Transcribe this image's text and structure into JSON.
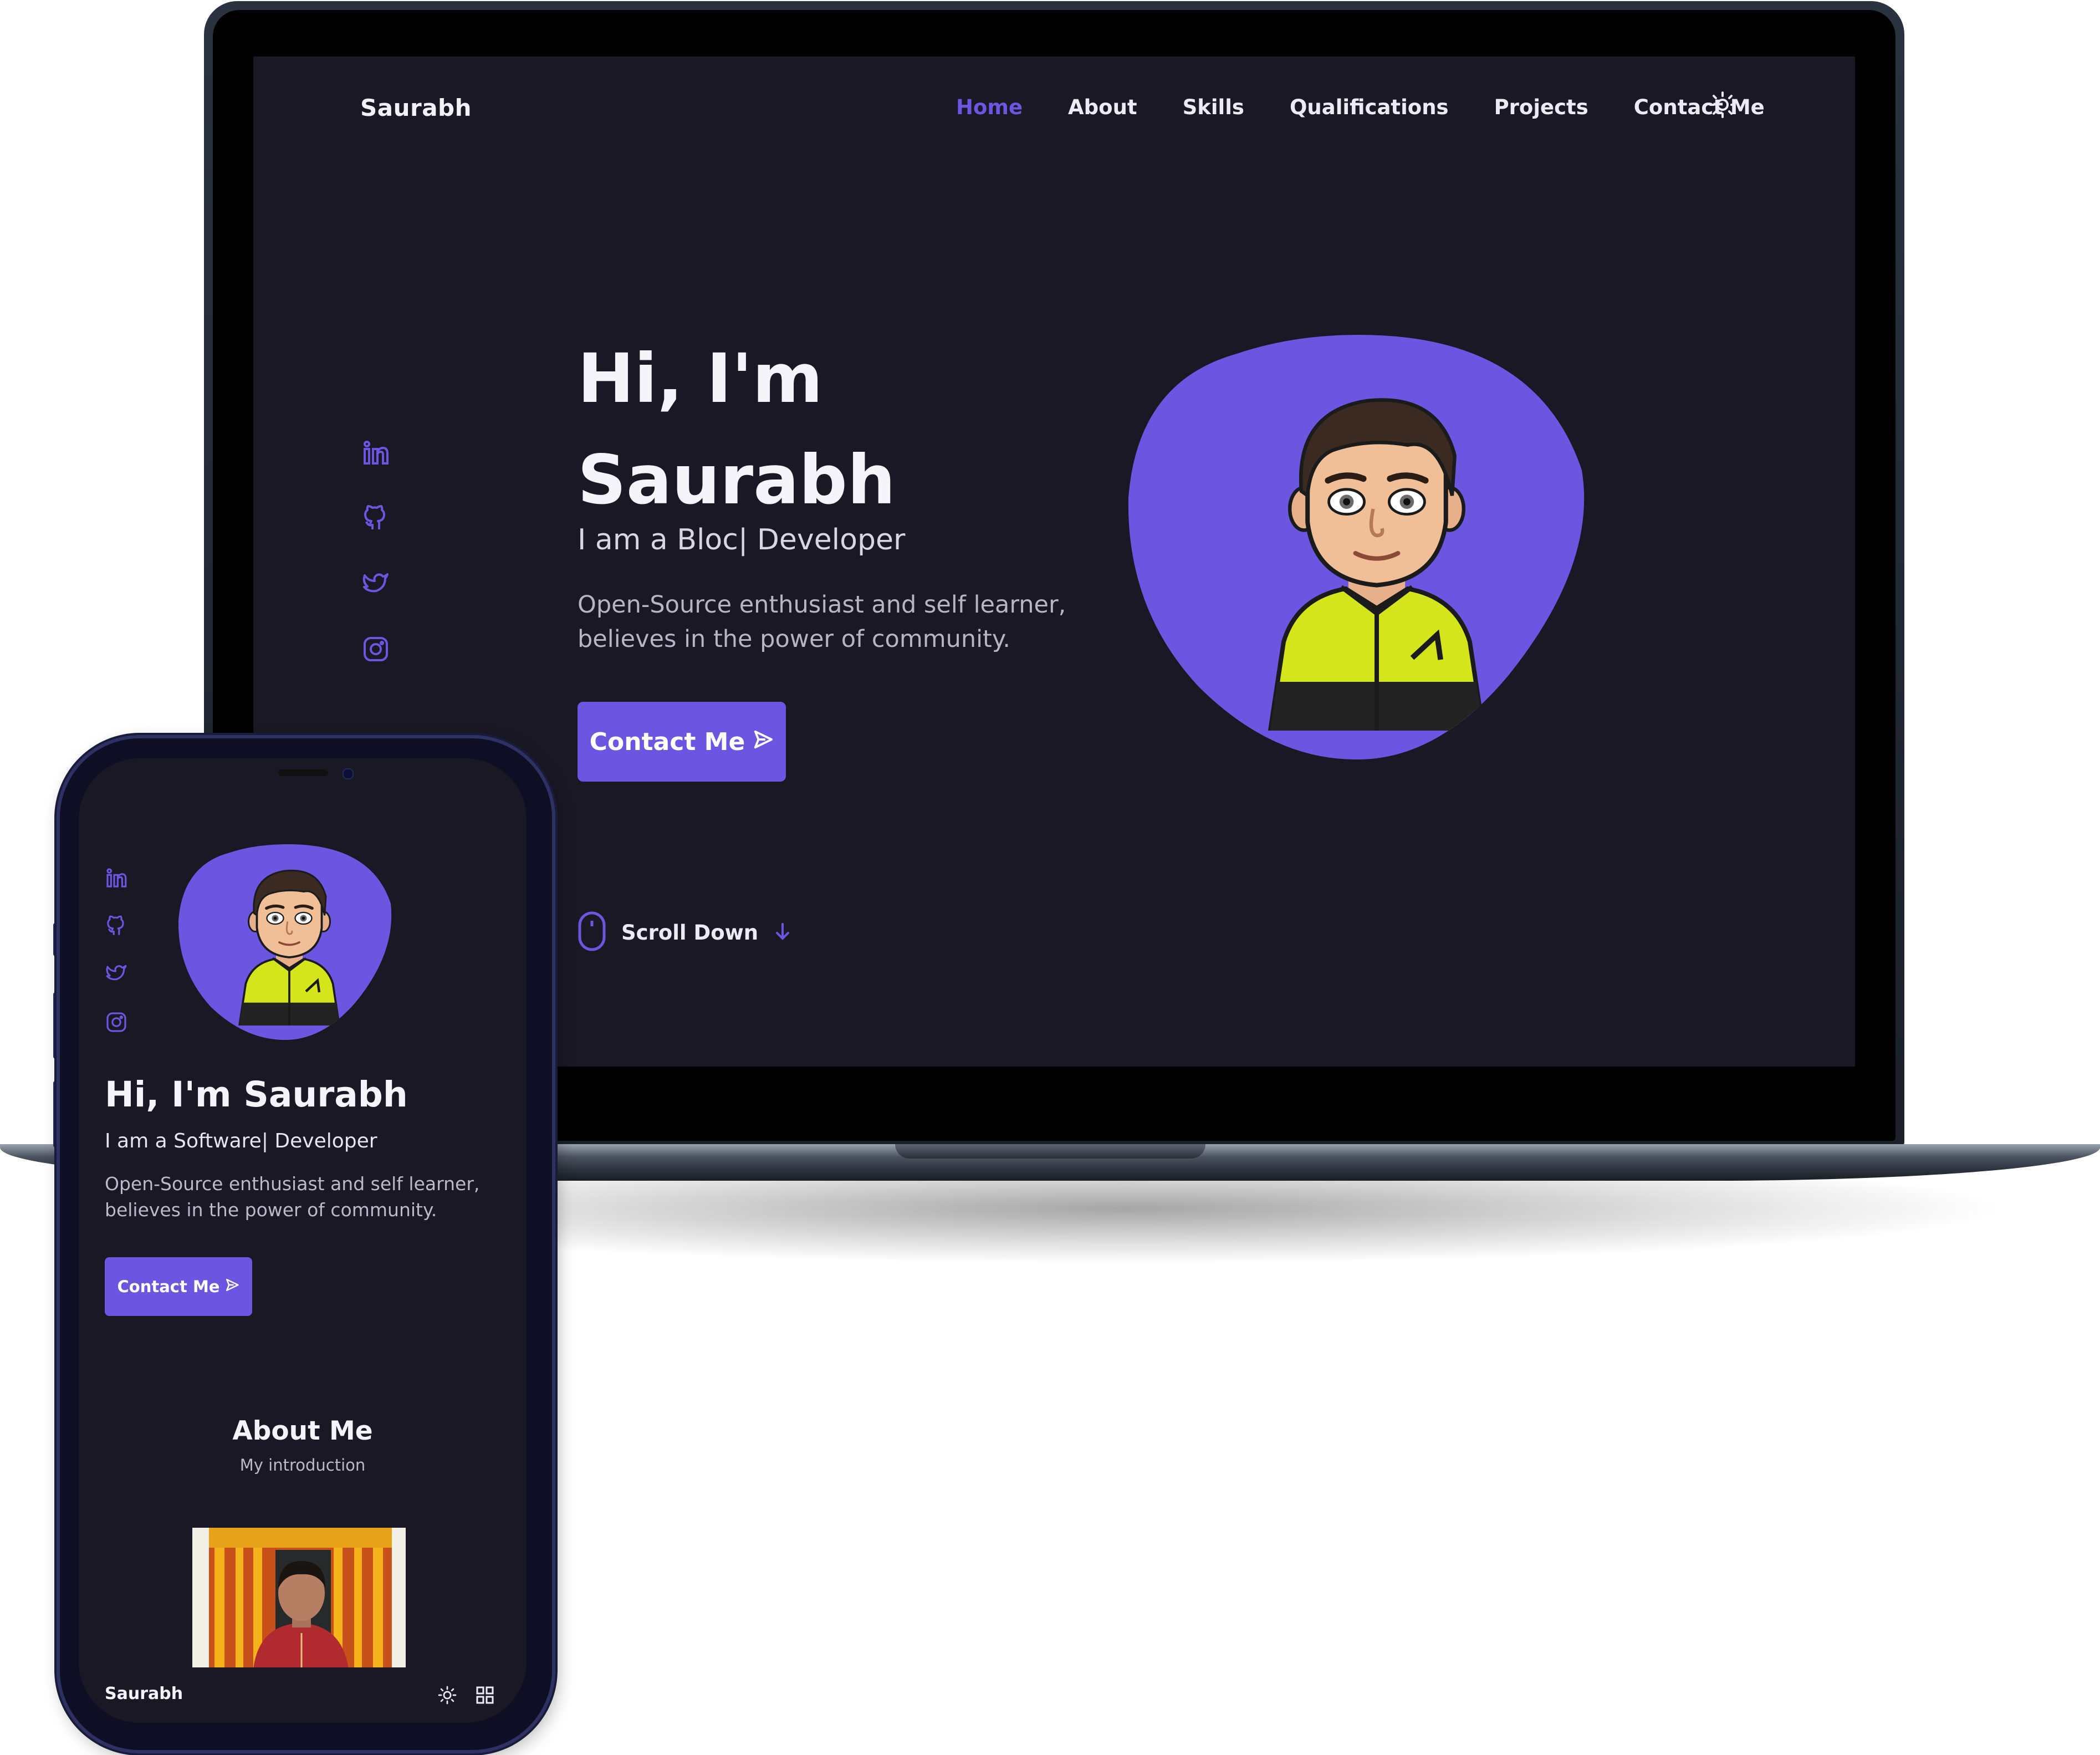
{
  "desktop": {
    "logo": "Saurabh",
    "nav": [
      {
        "label": "Home",
        "active": true
      },
      {
        "label": "About",
        "active": false
      },
      {
        "label": "Skills",
        "active": false
      },
      {
        "label": "Qualifications",
        "active": false
      },
      {
        "label": "Projects",
        "active": false
      },
      {
        "label": "Contact Me",
        "active": false
      }
    ],
    "theme_toggle_icon": "sun-icon",
    "socials": [
      "linkedin-icon",
      "github-icon",
      "twitter-icon",
      "instagram-icon"
    ],
    "hero": {
      "title_line1": "Hi, I'm",
      "title_line2": "Saurabh",
      "subtitle": "I am a Bloc| Developer",
      "description_line1": "Open-Source enthusiast and self learner,",
      "description_line2": "believes in the power of community.",
      "button_label": "Contact Me",
      "button_icon": "send-icon"
    },
    "scroll": {
      "label": "Scroll Down",
      "icon": "mouse-icon",
      "arrow_icon": "arrow-down-icon"
    }
  },
  "phone": {
    "socials": [
      "linkedin-icon",
      "github-icon",
      "twitter-icon",
      "instagram-icon"
    ],
    "hero": {
      "title": "Hi, I'm Saurabh",
      "subtitle": "I am a Software| Developer",
      "description_line1": "Open-Source enthusiast and self learner,",
      "description_line2": "believes in the power of community.",
      "button_label": "Contact Me"
    },
    "about": {
      "title": "About Me",
      "subtitle": "My introduction"
    },
    "footer": {
      "logo": "Saurabh",
      "icons": [
        "sun-icon",
        "grid-icon"
      ]
    }
  },
  "colors": {
    "accent": "#6C55E0",
    "background": "#1A1825",
    "text": "#F5F4FA",
    "muted": "#B7B4C4",
    "jacket": "#D4E51C"
  }
}
